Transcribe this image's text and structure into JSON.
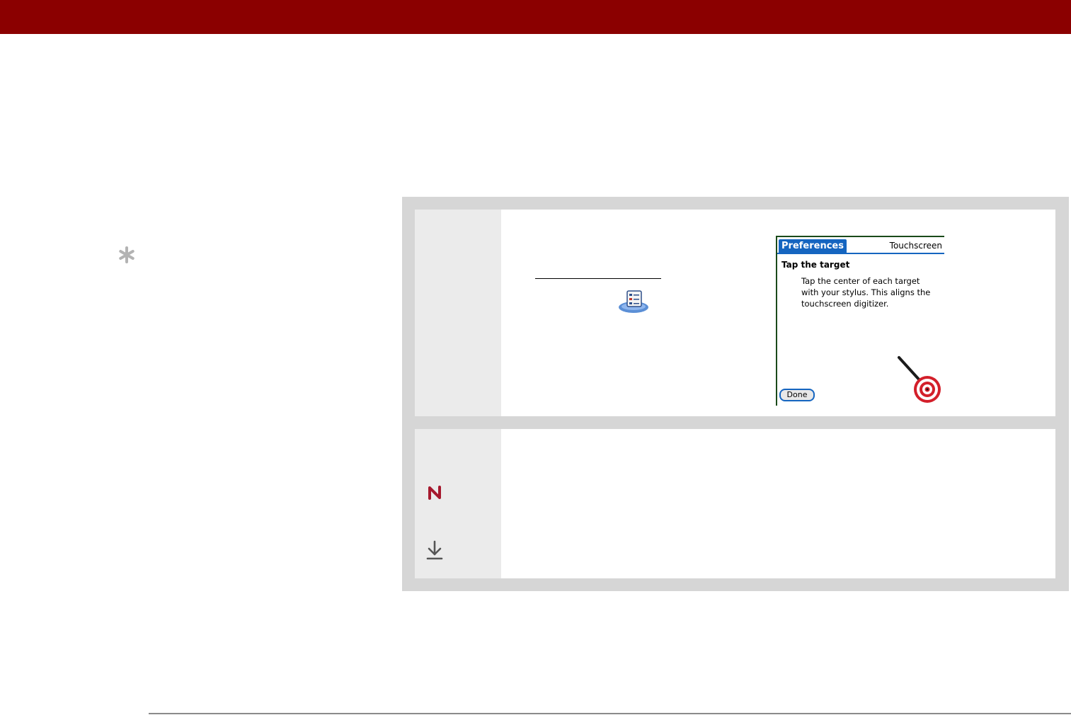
{
  "colors": {
    "header_bar": "#8b0000",
    "device_accent": "#1565c0",
    "target_red": "#d31f2a",
    "icon_maroon": "#a6192e"
  },
  "tip_icon": "asterisk-icon",
  "steps": [
    {
      "icon": "preferences-app-icon",
      "device_screen": {
        "title": "Preferences",
        "subtitle": "Touchscreen",
        "heading": "Tap the target",
        "body_lines": [
          "Tap the center of each target",
          "with your stylus.  This aligns the",
          "touchscreen digitizer."
        ],
        "done_label": "Done"
      }
    },
    {
      "icons": [
        "5-way-navigator-icon",
        "download-arrow-icon"
      ]
    }
  ]
}
